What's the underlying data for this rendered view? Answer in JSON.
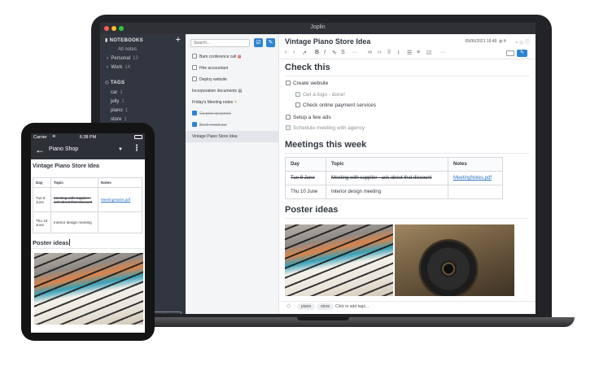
{
  "desktop": {
    "window_title": "Joplin",
    "sidebar": {
      "notebooks_header": "NOTEBOOKS",
      "all_notes": "All notes",
      "notebooks": [
        {
          "label": "Personal",
          "count": "13"
        },
        {
          "label": "Work",
          "count": "14"
        }
      ],
      "tags_header": "TAGS",
      "tags": [
        {
          "label": "car",
          "count": "1"
        },
        {
          "label": "jelly",
          "count": "1"
        },
        {
          "label": "piano",
          "count": "1"
        },
        {
          "label": "store",
          "count": "1"
        }
      ],
      "sync_label": "ize"
    },
    "notelist": {
      "search_placeholder": "Search...",
      "items": [
        {
          "label": "Bam conference call",
          "todo": true,
          "done": false
        },
        {
          "label": "Hire accountant",
          "todo": true,
          "done": false
        },
        {
          "label": "Deploy website",
          "todo": true,
          "done": false
        },
        {
          "label": "Incorporation documents",
          "todo": false,
          "done": false
        },
        {
          "label": "Friday's Meeting notes",
          "todo": false,
          "done": false
        },
        {
          "label": "Go pick up parcel",
          "todo": true,
          "done": true
        },
        {
          "label": "Book rental car",
          "todo": true,
          "done": true
        },
        {
          "label": "Vintage Piano Store Idea",
          "todo": false,
          "done": false
        }
      ]
    },
    "note": {
      "title": "Vintage Piano Store Idea",
      "date": "05/06/2021 16:49",
      "lang": "fr",
      "h_check": "Check this",
      "tasks": [
        {
          "label": "Create website",
          "done": false,
          "indent": 0
        },
        {
          "label": "Get a logo - done!",
          "done": true,
          "indent": 1
        },
        {
          "label": "Check online payment services",
          "done": false,
          "indent": 1
        },
        {
          "label": "Setup a few ads",
          "done": false,
          "indent": 0
        },
        {
          "label": "Schedule meeting with agency",
          "done": true,
          "indent": 0
        }
      ],
      "h_meetings": "Meetings this week",
      "table_headers": [
        "Day",
        "Topic",
        "Notes"
      ],
      "table_rows": [
        {
          "day": "Tue 8 June",
          "topic": "Meeting with supplier - ask about that discount",
          "notes": "MeetingNotes.pdf",
          "struck": true
        },
        {
          "day": "Thu 10 June",
          "topic": "Interior design meeting",
          "notes": "",
          "struck": false
        }
      ],
      "h_poster": "Poster ideas",
      "tags": [
        "piano",
        "store"
      ],
      "add_tags": "Click to add tags..."
    }
  },
  "mobile": {
    "carrier": "Carrier",
    "time": "6:38 PM",
    "notebook": "Piano Shop",
    "note_title": "Vintage Piano Store Idea",
    "table_headers": [
      "Day",
      "Topic",
      "Notes"
    ],
    "table_rows": [
      {
        "day": "Tue 8 June",
        "topic": "Meeting with supplier - ask about that discount",
        "notes": "MeetingNotes.pdf"
      },
      {
        "day": "Thu 10 June",
        "topic": "Interior design meeting",
        "notes": ""
      }
    ],
    "h_poster": "Poster ideas"
  }
}
